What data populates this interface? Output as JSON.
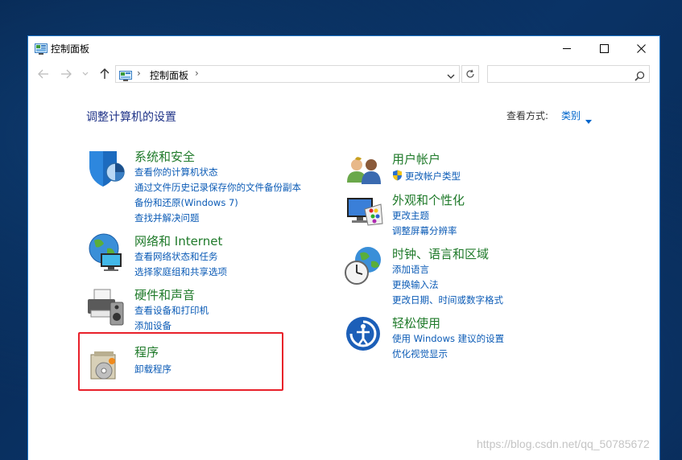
{
  "window": {
    "title": "控制面板",
    "icon": "control-panel-icon"
  },
  "address_bar": {
    "separator": "›",
    "crumb": "控制面板",
    "dropdown_icon": "chevron-down-icon",
    "refresh_icon": "refresh-icon"
  },
  "search": {
    "placeholder": "",
    "icon": "search-icon"
  },
  "main": {
    "heading": "调整计算机的设置",
    "view_by_label": "查看方式:",
    "view_by_value": "类别"
  },
  "categories": [
    {
      "title": "系统和安全",
      "icon": "shield-icon",
      "links": [
        "查看你的计算机状态",
        "通过文件历史记录保存你的文件备份副本",
        "备份和还原(Windows 7)",
        "查找并解决问题"
      ]
    },
    {
      "title": "网络和 Internet",
      "icon": "network-globe-icon",
      "links": [
        "查看网络状态和任务",
        "选择家庭组和共享选项"
      ]
    },
    {
      "title": "硬件和声音",
      "icon": "printer-speaker-icon",
      "links": [
        "查看设备和打印机",
        "添加设备"
      ]
    },
    {
      "title": "程序",
      "icon": "programs-disc-icon",
      "links": [
        "卸载程序"
      ]
    },
    {
      "title": "用户帐户",
      "icon": "users-icon",
      "links": [
        "更改帐户类型"
      ]
    },
    {
      "title": "外观和个性化",
      "icon": "monitor-palette-icon",
      "links": [
        "更改主题",
        "调整屏幕分辨率"
      ]
    },
    {
      "title": "时钟、语言和区域",
      "icon": "clock-globe-icon",
      "links": [
        "添加语言",
        "更换输入法",
        "更改日期、时间或数字格式"
      ]
    },
    {
      "title": "轻松使用",
      "icon": "ease-of-access-icon",
      "links": [
        "使用 Windows 建议的设置",
        "优化视觉显示"
      ]
    }
  ],
  "watermark": "https://blog.csdn.net/qq_50785672",
  "colors": {
    "category_title": "#1f7a2a",
    "link": "#0b5bb6",
    "heading": "#1e3287",
    "highlight_border": "#e8202a",
    "window_border": "#1a73c6"
  }
}
